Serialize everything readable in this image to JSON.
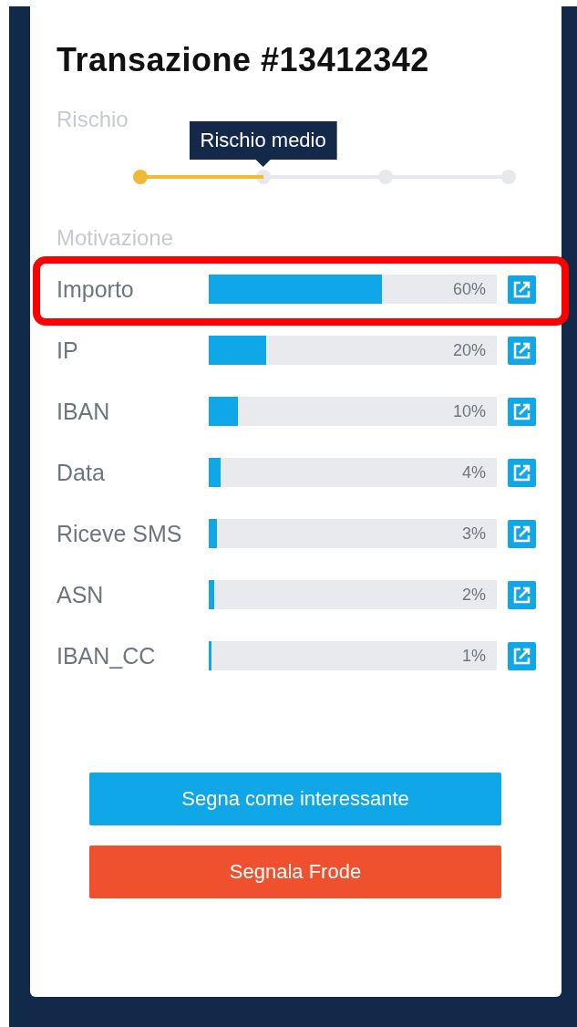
{
  "title": "Transazione #13412342",
  "risk": {
    "label": "Rischio",
    "level": 0.3333,
    "tooltip": "Rischio medio"
  },
  "motivation": {
    "label": "Motivazione",
    "rows": [
      {
        "name": "Importo",
        "level": 0.6,
        "reading": "60%",
        "highlighted": true
      },
      {
        "name": "IP",
        "level": 0.2,
        "reading": "20%",
        "highlighted": false
      },
      {
        "name": "IBAN",
        "level": 0.1,
        "reading": "10%",
        "highlighted": false
      },
      {
        "name": "Data",
        "level": 0.04,
        "reading": "4%",
        "highlighted": false
      },
      {
        "name": "Riceve SMS",
        "level": 0.03,
        "reading": "3%",
        "highlighted": false
      },
      {
        "name": "ASN",
        "level": 0.02,
        "reading": "2%",
        "highlighted": false
      },
      {
        "name": "IBAN_CC",
        "level": 0.01,
        "reading": "1%",
        "highlighted": false
      }
    ]
  },
  "buttons": [
    {
      "label": "Segna come interessante",
      "kind": "primary"
    },
    {
      "label": "Segnala Frode",
      "kind": "danger"
    }
  ]
}
